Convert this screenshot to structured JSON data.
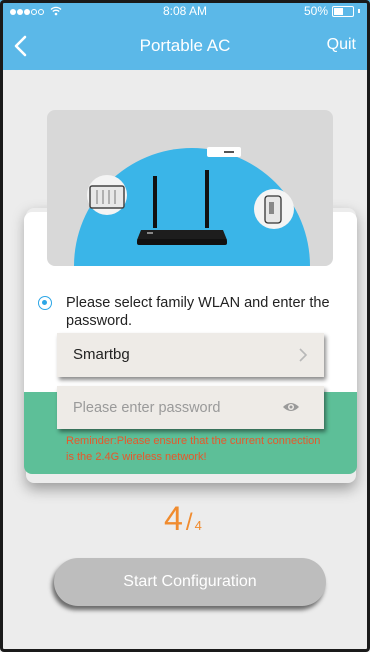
{
  "status_bar": {
    "time": "8:08 AM",
    "battery": "50%"
  },
  "nav": {
    "title": "Portable AC",
    "quit": "Quit"
  },
  "form": {
    "instruction": "Please select family WLAN and enter the password.",
    "wifi_name": "Smartbg",
    "password_placeholder": "Please enter password",
    "reminder": "Reminder:Please ensure that the current connection is the 2.4G wireless network!"
  },
  "step": {
    "current": "4",
    "slash": "/",
    "total": "4"
  },
  "start_button": "Start Configuration",
  "colors": {
    "accent": "#5bb8e8",
    "card_bottom": "#5dbf98",
    "step": "#f08b2e",
    "reminder": "#e8572a"
  }
}
